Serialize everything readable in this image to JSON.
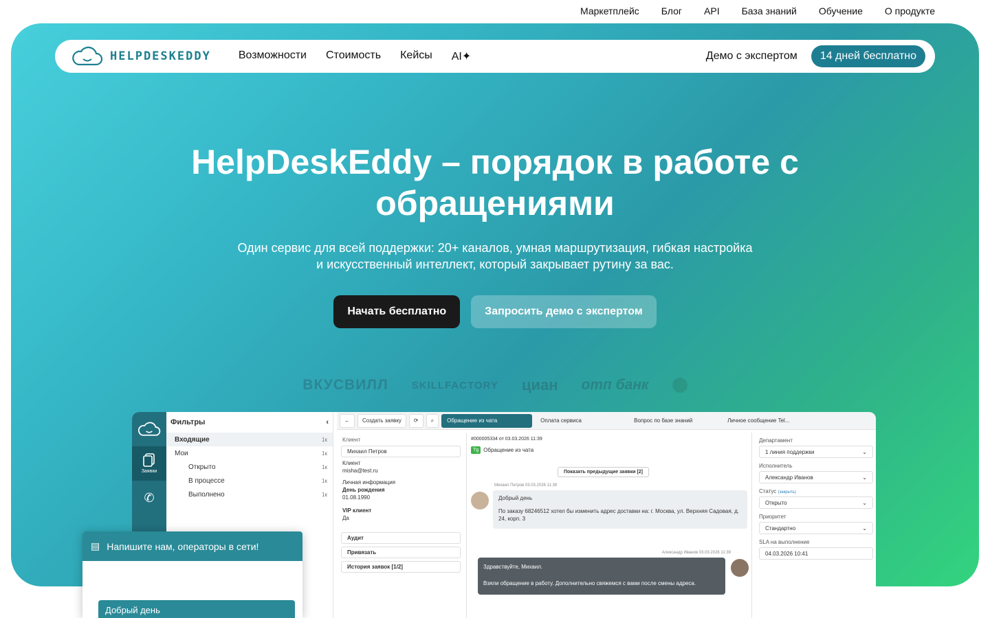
{
  "top_links": [
    "Маркетплейс",
    "Блог",
    "API",
    "База знаний",
    "Обучение",
    "О продукте"
  ],
  "logo_text": "HELPDESKEDDY",
  "nav": {
    "items": [
      "Возможности",
      "Стоимость",
      "Кейсы",
      "AI"
    ],
    "demo": "Демо с экспертом",
    "trial": "14 дней бесплатно"
  },
  "hero": {
    "title_line1": "HelpDeskEddy – порядок в работе с",
    "title_line2": "обращениями",
    "subtitle_line1": "Один сервис для всей поддержки: 20+ каналов, умная маршрутизация, гибкая настройка",
    "subtitle_line2": "и искусственный интеллект, который закрывает рутину за вас.",
    "cta_primary": "Начать бесплатно",
    "cta_secondary": "Запросить демо с экспертом"
  },
  "partner_logos": [
    "ВКУСВИЛЛ",
    "SKILLFACTORY",
    "циан",
    "отп банк"
  ],
  "app": {
    "rail_label": "Заявки",
    "filters_title": "Фильтры",
    "filters": [
      {
        "label": "Входящие",
        "count": "1к"
      },
      {
        "label": "Мои",
        "count": "1к"
      },
      {
        "label": "Открыто",
        "count": "1к"
      },
      {
        "label": "В процессе",
        "count": "1к"
      },
      {
        "label": "Выполнено",
        "count": "1к"
      }
    ],
    "toolbar_create": "Создать заявку",
    "tabs": [
      "Обращение из чата",
      "Оплата сервиса",
      "Вопрос по базе знаний",
      "Личное сообщение Tel..."
    ],
    "client": {
      "client_label": "Клиент",
      "client_name": "Михаил Петров",
      "client_sub": "Клиент",
      "email": "misha@test.ru",
      "personal": "Личная информация",
      "birthday_label": "День рождения",
      "birthday": "01.08.1990",
      "vip_label": "VIP клиент",
      "vip": "Да",
      "audit": "Аудит",
      "link": "Привязать",
      "history": "История заявок [1/2]"
    },
    "chat": {
      "ticket": "#000005334 от 03.03.2026 11:39",
      "source": "Обращение из чата",
      "show_prev": "Показать предыдущие заявки [2]",
      "msg1_meta": "Михаил Петров 03.03.2026 11:39",
      "msg1_title": "Добрый день",
      "msg1_text": "По заказу 68246512 хотел бы изменить адрес доставки на: г. Москва, ул. Верхняя Садовая, д. 24, корп. 3",
      "msg2_meta": "Александр Иванов 03.03.2026 11:39",
      "msg2_line1": "Здравствуйте, Михаил.",
      "msg2_line2": "Взяли обращение в работу. Дополнительно свяжемся с вами после смены адреса."
    },
    "props": {
      "dept_label": "Департамент",
      "dept": "1 линия поддержки",
      "exec_label": "Исполнитель",
      "exec": "Александр Иванов",
      "status_label": "Статус",
      "status_note": "(закрыть)",
      "status": "Открыто",
      "prio_label": "Приоритет",
      "prio": "Стандартно",
      "sla_label": "SLA на выполнение",
      "sla": "04.03.2026 10:41"
    }
  },
  "widget": {
    "header": "Напишите нам, операторы в сети!",
    "message": "Добрый день"
  }
}
